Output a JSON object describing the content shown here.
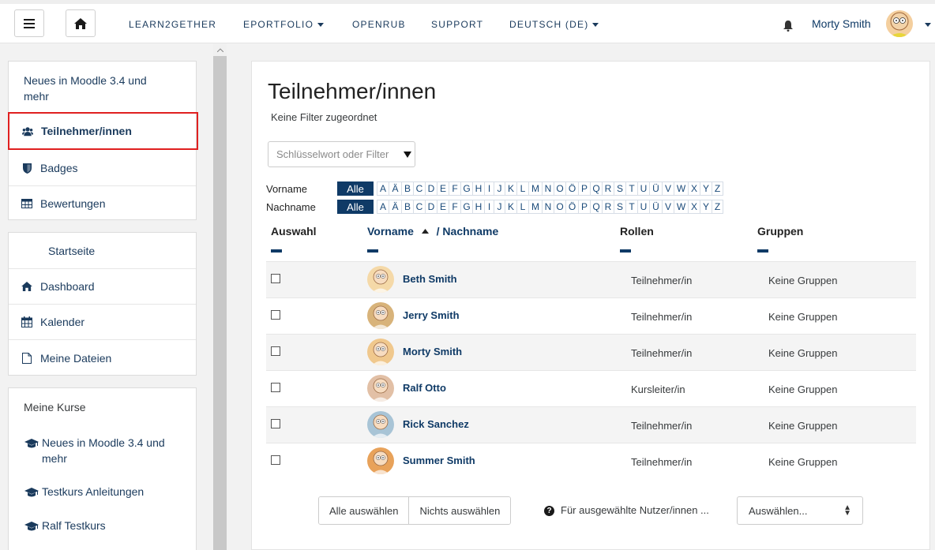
{
  "navbar": {
    "items": [
      {
        "label": "LEARN2GETHER",
        "dropdown": false
      },
      {
        "label": "EPORTFOLIO",
        "dropdown": true
      },
      {
        "label": "OPENRUB",
        "dropdown": false
      },
      {
        "label": "SUPPORT",
        "dropdown": false
      },
      {
        "label": "DEUTSCH (DE)",
        "dropdown": true
      }
    ],
    "user_name": "Morty Smith"
  },
  "sidebar": {
    "course_title": "Neues in Moodle 3.4 und mehr",
    "course_items": [
      {
        "label": "Teilnehmer/innen",
        "icon": "users-icon"
      },
      {
        "label": "Badges",
        "icon": "shield-icon"
      },
      {
        "label": "Bewertungen",
        "icon": "table-icon"
      }
    ],
    "nav_items": [
      {
        "label": "Startseite"
      },
      {
        "label": "Dashboard",
        "icon": "home-icon"
      },
      {
        "label": "Kalender",
        "icon": "calendar-icon"
      },
      {
        "label": "Meine Dateien",
        "icon": "file-icon"
      }
    ],
    "my_courses_title": "Meine Kurse",
    "my_courses": [
      {
        "label": "Neues in Moodle 3.4 und mehr"
      },
      {
        "label": "Testkurs Anleitungen"
      },
      {
        "label": "Ralf Testkurs"
      }
    ]
  },
  "main": {
    "title": "Teilnehmer/innen",
    "no_filter": "Keine Filter zugeordnet",
    "filter_placeholder": "Schlüsselwort oder Filter",
    "firstname_label": "Vorname",
    "lastname_label": "Nachname",
    "all_label": "Alle",
    "letters": [
      "A",
      "Ä",
      "B",
      "C",
      "D",
      "E",
      "F",
      "G",
      "H",
      "I",
      "J",
      "K",
      "L",
      "M",
      "N",
      "O",
      "Ö",
      "P",
      "Q",
      "R",
      "S",
      "T",
      "U",
      "Ü",
      "V",
      "W",
      "X",
      "Y",
      "Z"
    ],
    "columns": {
      "select": "Auswahl",
      "firstname": "Vorname",
      "lastname": "/ Nachname",
      "roles": "Rollen",
      "groups": "Gruppen"
    },
    "rows": [
      {
        "name": "Beth Smith",
        "role": "Teilnehmer/in",
        "group": "Keine Gruppen",
        "avatar": "#f5d9a8"
      },
      {
        "name": "Jerry Smith",
        "role": "Teilnehmer/in",
        "group": "Keine Gruppen",
        "avatar": "#d8b37a"
      },
      {
        "name": "Morty Smith",
        "role": "Teilnehmer/in",
        "group": "Keine Gruppen",
        "avatar": "#f0c88d"
      },
      {
        "name": "Ralf Otto",
        "role": "Kursleiter/in",
        "group": "Keine Gruppen",
        "avatar": "#e2c0a6"
      },
      {
        "name": "Rick Sanchez",
        "role": "Teilnehmer/in",
        "group": "Keine Gruppen",
        "avatar": "#a8c4d6"
      },
      {
        "name": "Summer Smith",
        "role": "Teilnehmer/in",
        "group": "Keine Gruppen",
        "avatar": "#e8a25a"
      }
    ],
    "select_all": "Alle auswählen",
    "select_none": "Nichts auswählen",
    "for_selected": "Für ausgewählte Nutzer/innen ...",
    "action_select": "Auswählen..."
  },
  "colors": {
    "brand": "#0f3a66",
    "active_border": "#e02020"
  }
}
